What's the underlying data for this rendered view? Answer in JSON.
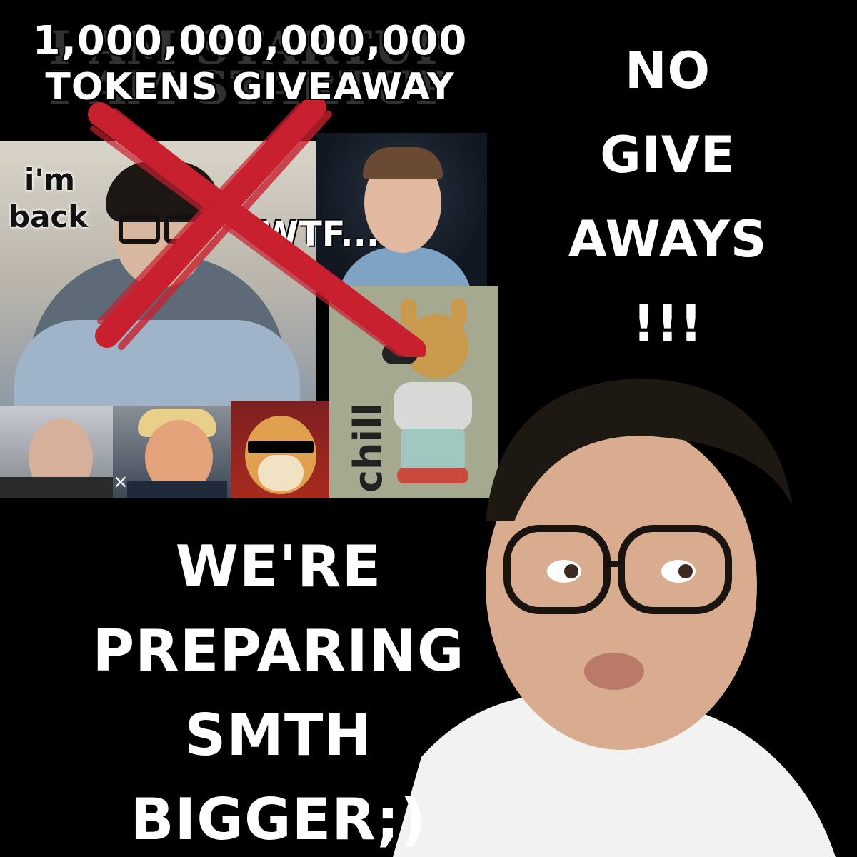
{
  "headline": {
    "amount": "1,000,000,000,000",
    "subtitle": "TOKENS GIVEAWAY"
  },
  "watermark": {
    "line1": "I AM STARTUP",
    "line2": "I AM STARTUP"
  },
  "collage": {
    "tile_back_caption_line1": "i'm",
    "tile_back_caption_line2": "back",
    "tile_zuck_caption": "WTF...",
    "tile_dog_caption": "chill",
    "tile_collab_mark": "×"
  },
  "right_column": {
    "lines": [
      "NO",
      "GIVE",
      "AWAYS",
      "!!!"
    ]
  },
  "bottom_left": {
    "lines": [
      "WE'RE",
      "PREPARING",
      "SMTH",
      "BIGGER;)"
    ]
  },
  "colors": {
    "background": "#000000",
    "text": "#ffffff",
    "cross": "#c8202f"
  },
  "icons": {
    "cross_mark": "red-x-icon"
  }
}
